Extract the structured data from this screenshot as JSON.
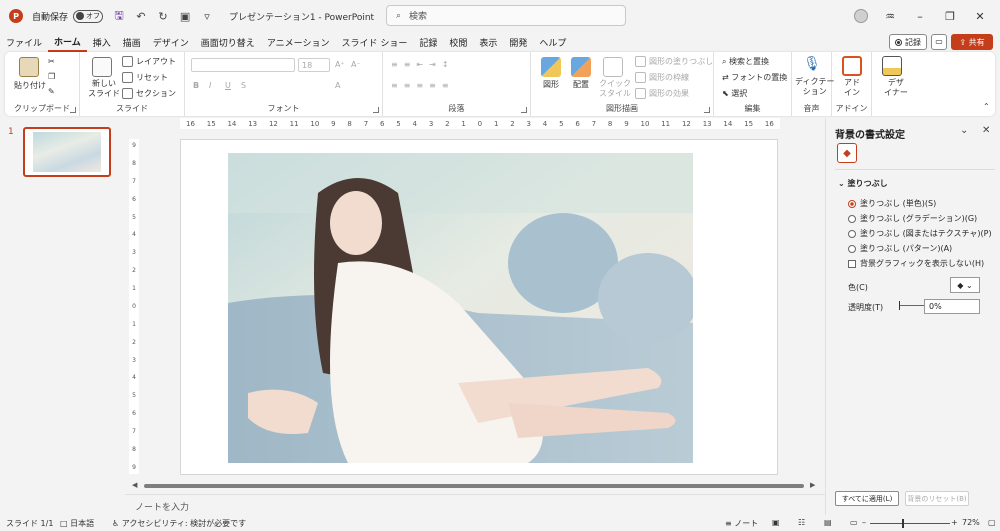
{
  "titlebar": {
    "logo": "P",
    "autosave_label": "自動保存",
    "autosave_state": "オフ",
    "doc_title": "プレゼンテーション1 - PowerPoint",
    "search_placeholder": "検索",
    "icons": [
      "save-icon",
      "undo-icon",
      "redo-icon",
      "present-icon",
      "customize-icon"
    ]
  },
  "menu": {
    "tabs": [
      "ファイル",
      "ホーム",
      "挿入",
      "描画",
      "デザイン",
      "画面切り替え",
      "アニメーション",
      "スライド ショー",
      "記録",
      "校閲",
      "表示",
      "開発",
      "ヘルプ"
    ],
    "active_tab": "ホーム",
    "record_label": "記録",
    "share_label": "共有"
  },
  "ribbon": {
    "clipboard": {
      "paste": "貼り付け",
      "label": "クリップボード"
    },
    "slides": {
      "new_slide": "新しい\nスライド",
      "layout": "レイアウト",
      "reset": "リセット",
      "section": "セクション",
      "label": "スライド"
    },
    "font": {
      "size": "18",
      "bold": "B",
      "italic": "I",
      "underline": "U",
      "strike": "S",
      "label": "フォント"
    },
    "paragraph": {
      "label": "段落"
    },
    "drawing": {
      "shapes": "図形",
      "arrange": "配置",
      "quick_styles": "クイック\nスタイル",
      "fill": "図形の塗りつぶし",
      "outline": "図形の枠線",
      "effects": "図形の効果",
      "label": "図形描画"
    },
    "editing": {
      "find": "検索と置換",
      "replace_font": "フォントの置換",
      "select": "選択",
      "label": "編集"
    },
    "voice": {
      "dictate": "ディクテー\nション",
      "label": "音声"
    },
    "addins": {
      "addins": "アド\nイン",
      "label": "アドイン"
    },
    "designer": {
      "label": "デザ\nイナー"
    }
  },
  "thumbnails": {
    "slide_number": "1"
  },
  "ruler": {
    "h_ticks": [
      "16",
      "15",
      "14",
      "13",
      "12",
      "11",
      "10",
      "9",
      "8",
      "7",
      "6",
      "5",
      "4",
      "3",
      "2",
      "1",
      "0",
      "1",
      "2",
      "3",
      "4",
      "5",
      "6",
      "7",
      "8",
      "9",
      "10",
      "11",
      "12",
      "13",
      "14",
      "15",
      "16"
    ],
    "v_ticks": [
      "9",
      "8",
      "7",
      "6",
      "5",
      "4",
      "3",
      "2",
      "1",
      "0",
      "1",
      "2",
      "3",
      "4",
      "5",
      "6",
      "7",
      "8",
      "9"
    ]
  },
  "notes_placeholder": "ノートを入力",
  "pane": {
    "title": "背景の書式設定",
    "section": "塗りつぶし",
    "options": [
      {
        "label": "塗りつぶし (単色)(S)",
        "selected": true
      },
      {
        "label": "塗りつぶし (グラデーション)(G)",
        "selected": false
      },
      {
        "label": "塗りつぶし (図またはテクスチャ)(P)",
        "selected": false
      },
      {
        "label": "塗りつぶし (パターン)(A)",
        "selected": false
      }
    ],
    "hide_graphics": "背景グラフィックを表示しない(H)",
    "color_label": "色(C)",
    "transparency_label": "透明度(T)",
    "transparency_value": "0%",
    "apply_all": "すべてに適用(L)",
    "reset_background": "背景のリセット(B)"
  },
  "status": {
    "slide": "スライド 1/1",
    "language": "日本語",
    "accessibility": "アクセシビリティ: 検討が必要です",
    "notes": "ノート",
    "zoom": "72%"
  }
}
